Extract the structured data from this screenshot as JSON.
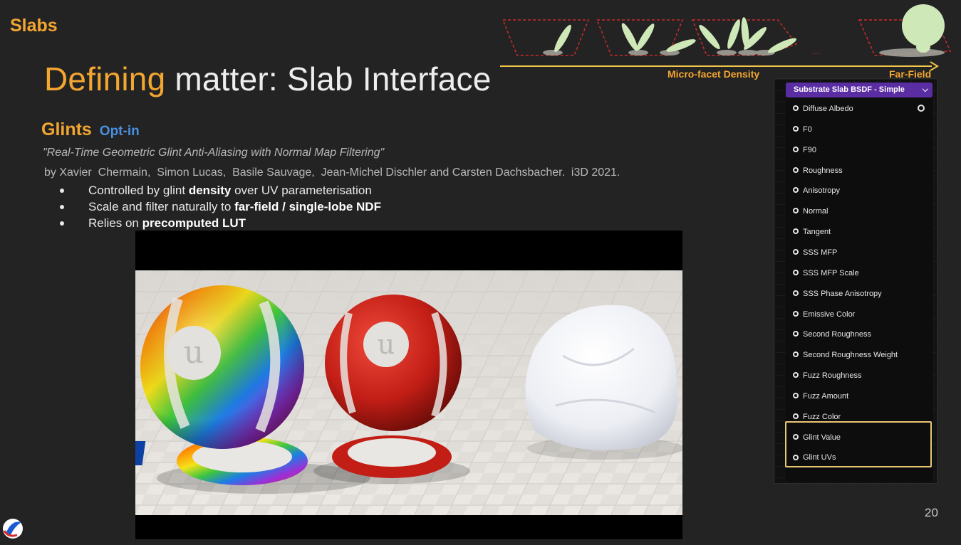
{
  "slide": {
    "section": "Slabs",
    "title_highlight": "Defining",
    "title_rest": " matter: Slab Interface",
    "subheading": "Glints",
    "subheading_tag": "Opt-in",
    "paper_title": "\"Real-Time Geometric Glint Anti-Aliasing with Normal Map Filtering\"",
    "paper_authors": "by Xavier  Chermain,  Simon Lucas,  Basile Sauvage,  Jean-Michel Dischler and Carsten Dachsbacher.  i3D 2021.",
    "bullets": [
      {
        "pre": "Controlled by glint ",
        "bold": "density",
        "post": " over UV parameterisation"
      },
      {
        "pre": "Scale and filter naturally to ",
        "bold": "far-field / single-lobe NDF",
        "post": ""
      },
      {
        "pre": "Relies on ",
        "bold": "precomputed LUT",
        "post": ""
      }
    ],
    "page_number": "20"
  },
  "diagram": {
    "left_label": "Micro-facet Density",
    "right_label": "Far-Field",
    "ellipsis": "...",
    "lobe_color": "#cfe8b8",
    "dash_color": "#cc2b2b",
    "arrow_color": "#f3c74a"
  },
  "node": {
    "title": "Substrate Slab BSDF - Simple",
    "header_color": "#5a2da3",
    "highlight_color": "#e8c775",
    "inputs": [
      "Diffuse Albedo",
      "F0",
      "F90",
      "Roughness",
      "Anisotropy",
      "Normal",
      "Tangent",
      "SSS MFP",
      "SSS MFP Scale",
      "SSS Phase Anisotropy",
      "Emissive Color",
      "Second Roughness",
      "Second Roughness Weight",
      "Fuzz Roughness",
      "Fuzz Amount",
      "Fuzz Color",
      "Glint Value",
      "Glint UVs"
    ],
    "highlighted_inputs": [
      "Glint Value",
      "Glint UVs"
    ]
  },
  "render": {
    "objects": [
      "rainbow-glint-sphere",
      "red-glint-sphere",
      "white-glint-cloth"
    ]
  }
}
